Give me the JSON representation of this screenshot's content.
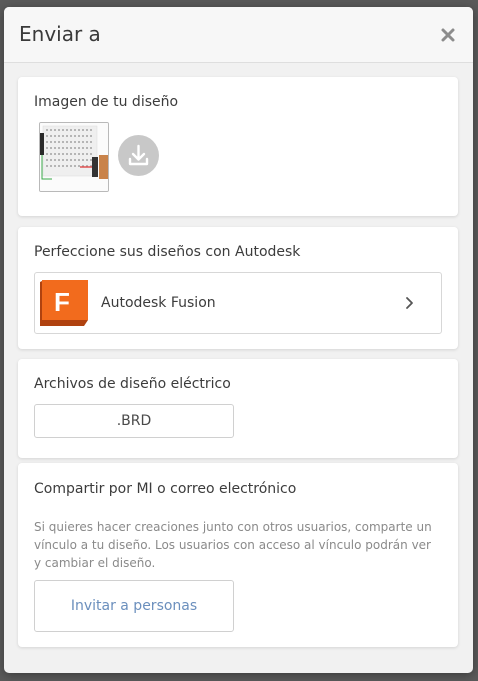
{
  "dialog": {
    "title": "Enviar a",
    "close_icon": "close-icon"
  },
  "image_section": {
    "title": "Imagen de tu diseño",
    "download_icon": "download-icon"
  },
  "autodesk_section": {
    "title": "Perfeccione sus diseños con Autodesk",
    "fusion_label": "Autodesk Fusion",
    "fusion_letter": "F",
    "brand_color": "#f26b1d"
  },
  "files_section": {
    "title": "Archivos de diseño eléctrico",
    "brd_label": ".BRD"
  },
  "share_section": {
    "title": "Compartir por MI o correo electrónico",
    "description": "Si quieres hacer creaciones junto con otros usuarios, comparte un vínculo a tu diseño. Los usuarios con acceso al vínculo podrán ver y cambiar el diseño.",
    "invite_label": "Invitar a personas",
    "link_color": "#6b8fbd"
  }
}
